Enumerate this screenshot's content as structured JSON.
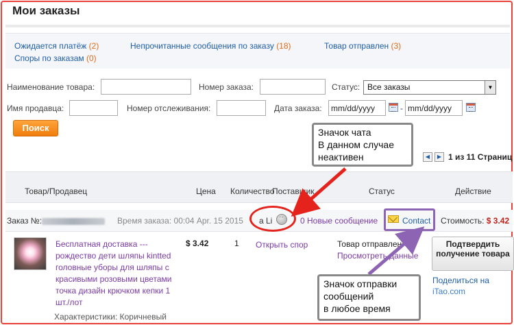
{
  "page": {
    "title": "Мои заказы"
  },
  "summary": {
    "awaiting_payment": {
      "label": "Ожидается платёж",
      "count": "(2)"
    },
    "unread_messages": {
      "label": "Непрочитанные сообщения по заказу",
      "count": "(18)"
    },
    "item_shipped": {
      "label": "Товар отправлен",
      "count": "(3)"
    },
    "disputes": {
      "label": "Споры по заказам",
      "count": "(0)"
    }
  },
  "filters": {
    "product_name_label": "Наименование товара:",
    "order_number_label": "Номер заказа:",
    "status_label": "Статус:",
    "status_value": "Все заказы",
    "seller_name_label": "Имя продавца:",
    "tracking_label": "Номер отслеживания:",
    "order_date_label": "Дата заказа:",
    "date_from_value": "mm/dd/yyyy",
    "date_to_value": "mm/dd/yyyy",
    "date_separator": "-",
    "search_button": "Поиск"
  },
  "pager": {
    "text": "1 из 11 Страниц"
  },
  "table": {
    "columns": {
      "product": "Товар/Продавец",
      "price": "Цена",
      "quantity": "Количество",
      "supplier": "Поставщик",
      "status": "Статус",
      "action": "Действие"
    }
  },
  "order": {
    "number_label": "Заказ №:",
    "time_label": "Время заказа:",
    "time_value": "00:04 Apr. 15 2015",
    "seller_name": "a Li",
    "new_messages": "0 Новые сообщение",
    "contact_label": "Contact",
    "cost_label": "Стоимость:",
    "cost_value": "$ 3.42",
    "product_title": "Бесплатная доставка --- рождество дети шляпы kintted головные уборы для шляпы с красивыми розовыми цветами точка дизайн крючком кепки 1 шт./лот",
    "product_attrs": "Характеристики: Коричневый",
    "price": "$ 3.42",
    "quantity": "1",
    "open_dispute": "Открыть спор",
    "status_text": "Товар отправлен",
    "view_details": "Просмотреть данные",
    "confirm_button": "Подтвердить получение товара",
    "share_label": "Поделиться на",
    "share_site": "iTao.com"
  },
  "annotations": {
    "chat_icon_note": [
      "Значок чата",
      "В данном случае",
      "неактивен"
    ],
    "message_icon_note": [
      "Значок отправки",
      "сообщений",
      "в любое время"
    ]
  },
  "colors": {
    "link": "#1f5da5",
    "count": "#e06c1a",
    "frame": "#e8433a",
    "accent_button": "#f07d0e",
    "red_annotation": "#e3231c",
    "purple_annotation": "#8d64b3"
  }
}
